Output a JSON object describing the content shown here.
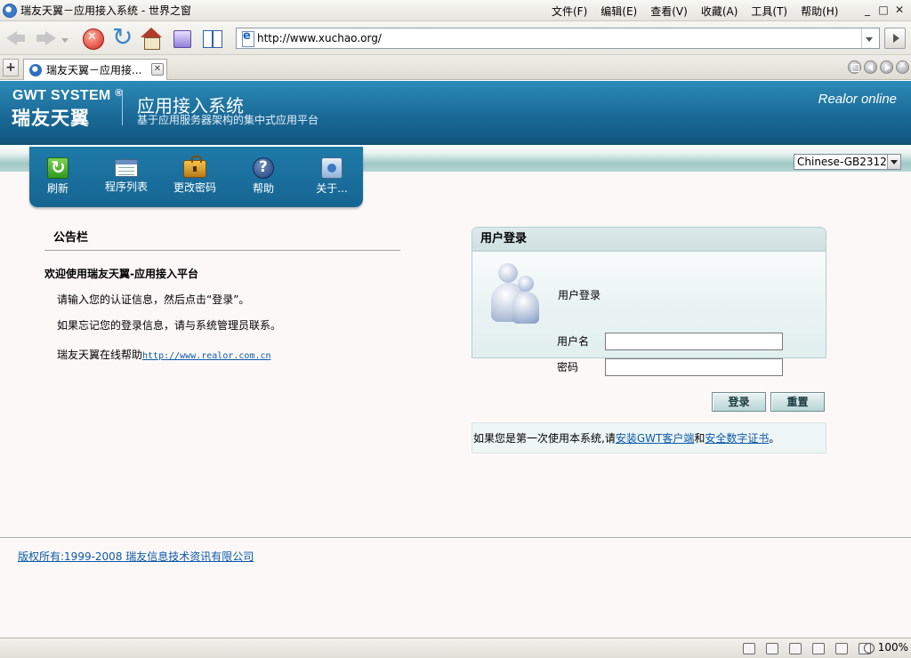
{
  "window": {
    "title": "瑞友天翼－应用接入系统 - 世界之窗",
    "menu": [
      "文件(F)",
      "编辑(E)",
      "查看(V)",
      "收藏(A)",
      "工具(T)",
      "帮助(H)"
    ],
    "controls": [
      "_",
      "□",
      "✕"
    ]
  },
  "navbar": {
    "icons": [
      "back-icon",
      "forward-icon",
      "dropdown-icon",
      "stop-icon",
      "refresh-icon",
      "home-icon",
      "history-icon",
      "favorites-icon"
    ],
    "address": "http://www.xuchao.org/"
  },
  "tabs": {
    "new_tab": "+",
    "active_label": "瑞友天翼－应用接...",
    "close": "✕"
  },
  "header": {
    "logo_en": "GWT SYSTEM",
    "logo_reg": "®",
    "logo_cn": "瑞友天翼",
    "system_title": "应用接入系统",
    "system_subtitle": "基于应用服务器架构的集中式应用平台",
    "tagline": "Realor online"
  },
  "encoding": {
    "selected": "Chinese-GB2312"
  },
  "toolbar": {
    "items": [
      {
        "label": "刷新",
        "icon": "refresh-icon"
      },
      {
        "label": "程序列表",
        "icon": "program-list-icon"
      },
      {
        "label": "更改密码",
        "icon": "change-password-icon"
      },
      {
        "label": "帮助",
        "icon": "help-icon"
      },
      {
        "label": "关于...",
        "icon": "about-icon"
      }
    ]
  },
  "bulletin": {
    "title": "公告栏",
    "heading": "欢迎使用瑞友天翼-应用接入平台",
    "line1": "请输入您的认证信息，然后点击“登录”。",
    "line2": "如果忘记您的登录信息，请与系统管理员联系。",
    "help_prefix": "瑞友天翼在线帮助",
    "help_link": "http://www.realor.com.cn"
  },
  "login": {
    "title": "用户登录",
    "subtitle": "用户登录",
    "username_label": "用户名",
    "username_value": "",
    "password_label": "密码",
    "password_value": "",
    "login_button": "登录",
    "reset_button": "重置"
  },
  "first_time": {
    "prefix": "如果您是第一次使用本系统,请",
    "link_client": "安装GWT客户端",
    "middle": "和",
    "link_cert": "安全数字证书",
    "suffix": "。"
  },
  "footer": {
    "copyright": "版权所有:1999-2008 瑞友信息技术资讯有限公司"
  },
  "statusbar": {
    "zoom": "100%"
  },
  "colors": {
    "header_blue": "#1a6a97",
    "link_blue": "#0b5aa8",
    "login_panel": "#e2efef"
  }
}
